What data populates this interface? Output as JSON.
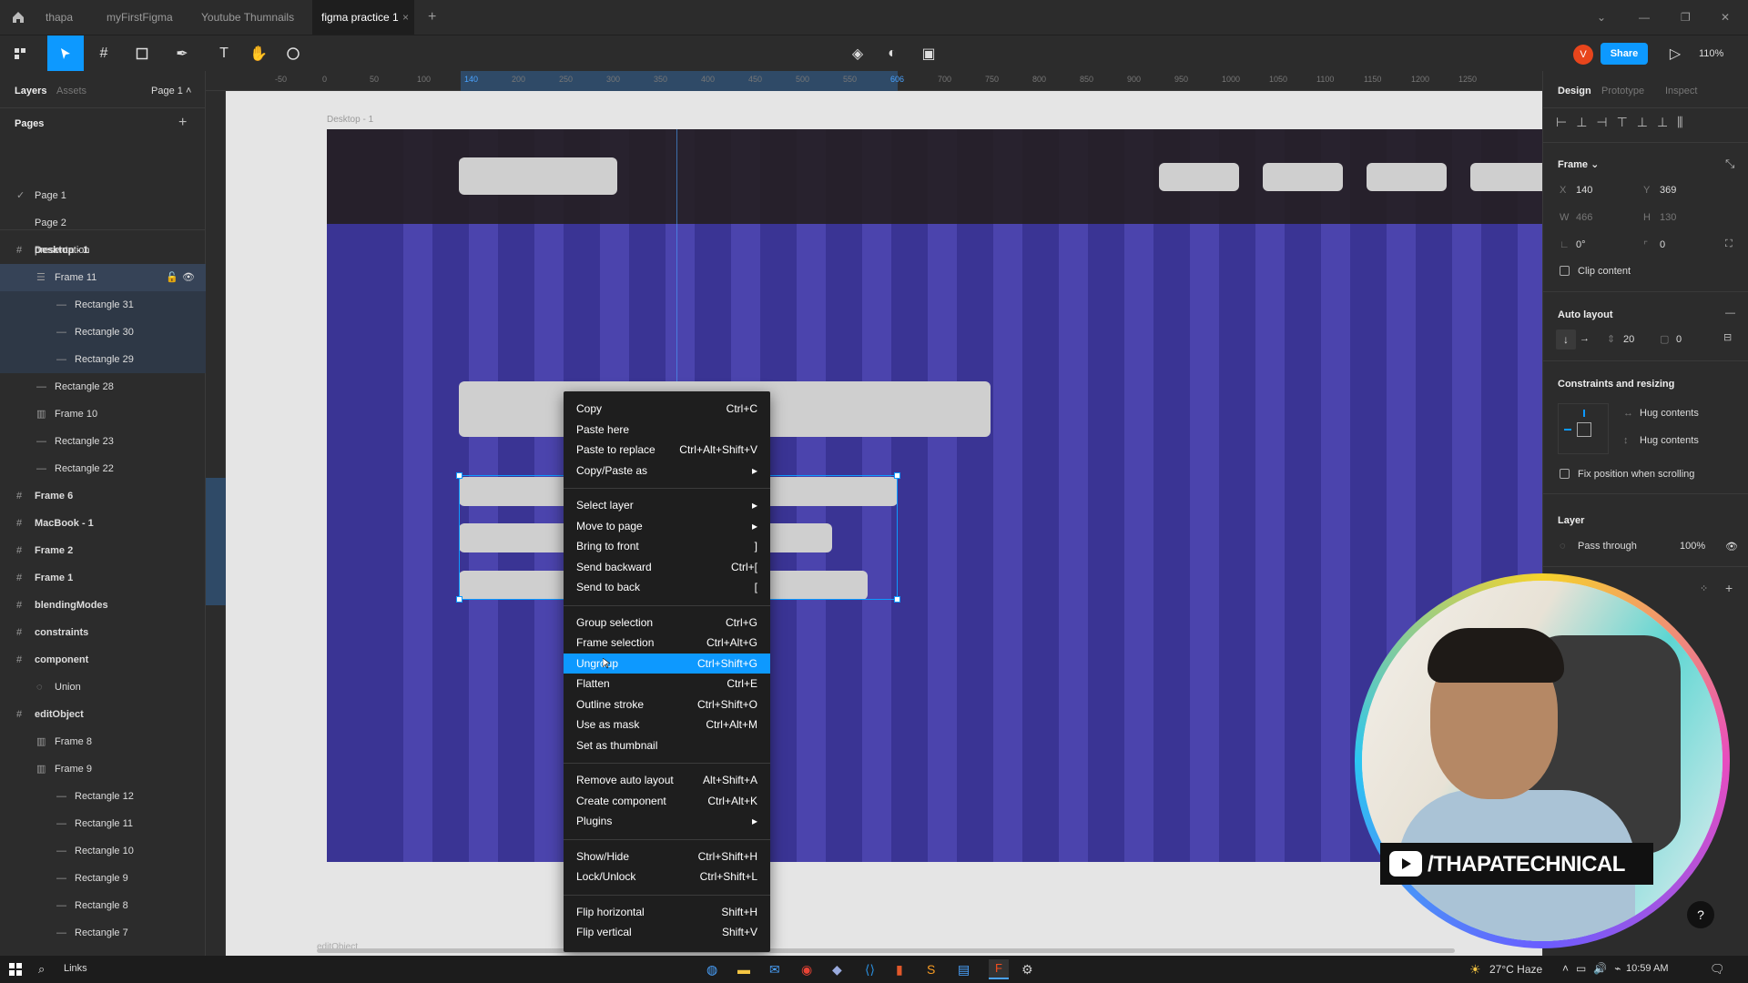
{
  "tabs": [
    {
      "label": "thapa"
    },
    {
      "label": "myFirstFigma"
    },
    {
      "label": "Youtube Thumnails"
    },
    {
      "label": "figma practice 1"
    }
  ],
  "toolbar": {
    "avatar": "V",
    "share": "Share",
    "zoom": "110%"
  },
  "left_panel": {
    "tab_layers": "Layers",
    "tab_assets": "Assets",
    "page_selector": "Page 1",
    "pages_title": "Pages",
    "pages": [
      "Page 1",
      "Page 2",
      "presentation"
    ],
    "layers": [
      {
        "label": "Desktop - 1",
        "icon": "#",
        "indent": 0,
        "bold": true
      },
      {
        "label": "Frame 11",
        "icon": "☰",
        "indent": 1,
        "bold": false,
        "selected": true
      },
      {
        "label": "Rectangle 31",
        "icon": "—",
        "indent": 2,
        "bold": false,
        "child": true
      },
      {
        "label": "Rectangle 30",
        "icon": "—",
        "indent": 2,
        "bold": false,
        "child": true
      },
      {
        "label": "Rectangle 29",
        "icon": "—",
        "indent": 2,
        "bold": false,
        "child": true
      },
      {
        "label": "Rectangle 28",
        "icon": "—",
        "indent": 1,
        "bold": false
      },
      {
        "label": "Frame 10",
        "icon": "▥",
        "indent": 1,
        "bold": false
      },
      {
        "label": "Rectangle 23",
        "icon": "—",
        "indent": 1,
        "bold": false
      },
      {
        "label": "Rectangle 22",
        "icon": "—",
        "indent": 1,
        "bold": false
      },
      {
        "label": "Frame 6",
        "icon": "#",
        "indent": 0,
        "bold": true
      },
      {
        "label": "MacBook - 1",
        "icon": "#",
        "indent": 0,
        "bold": true
      },
      {
        "label": "Frame 2",
        "icon": "#",
        "indent": 0,
        "bold": true
      },
      {
        "label": "Frame 1",
        "icon": "#",
        "indent": 0,
        "bold": true
      },
      {
        "label": "blendingModes",
        "icon": "#",
        "indent": 0,
        "bold": true
      },
      {
        "label": "constraints",
        "icon": "#",
        "indent": 0,
        "bold": true
      },
      {
        "label": "component",
        "icon": "#",
        "indent": 0,
        "bold": true
      },
      {
        "label": "Union",
        "icon": "◌",
        "indent": 1,
        "bold": false
      },
      {
        "label": "editObject",
        "icon": "#",
        "indent": 0,
        "bold": true
      },
      {
        "label": "Frame 8",
        "icon": "▥",
        "indent": 1,
        "bold": false
      },
      {
        "label": "Frame 9",
        "icon": "▥",
        "indent": 1,
        "bold": false
      },
      {
        "label": "Rectangle 12",
        "icon": "—",
        "indent": 2,
        "bold": false
      },
      {
        "label": "Rectangle 11",
        "icon": "—",
        "indent": 2,
        "bold": false
      },
      {
        "label": "Rectangle 10",
        "icon": "—",
        "indent": 2,
        "bold": false
      },
      {
        "label": "Rectangle 9",
        "icon": "—",
        "indent": 2,
        "bold": false
      },
      {
        "label": "Rectangle 8",
        "icon": "—",
        "indent": 2,
        "bold": false
      },
      {
        "label": "Rectangle 7",
        "icon": "—",
        "indent": 2,
        "bold": false
      }
    ]
  },
  "ruler": {
    "top_ticks": [
      "-50",
      "0",
      "50",
      "100",
      "140",
      "200",
      "250",
      "300",
      "350",
      "400",
      "450",
      "500",
      "550",
      "606",
      "700",
      "750",
      "800",
      "850",
      "900",
      "950",
      "1000",
      "1050",
      "1100",
      "1150",
      "1200",
      "1250"
    ],
    "highlight_start": "140",
    "highlight_end": "606"
  },
  "canvas": {
    "frame_label": "Desktop - 1",
    "bottom_label": "editObject"
  },
  "context_menu": {
    "groups": [
      [
        {
          "label": "Copy",
          "shortcut": "Ctrl+C"
        },
        {
          "label": "Paste here",
          "shortcut": ""
        },
        {
          "label": "Paste to replace",
          "shortcut": "Ctrl+Alt+Shift+V"
        },
        {
          "label": "Copy/Paste as",
          "shortcut": "▸"
        }
      ],
      [
        {
          "label": "Select layer",
          "shortcut": "▸"
        },
        {
          "label": "Move to page",
          "shortcut": "▸"
        },
        {
          "label": "Bring to front",
          "shortcut": "]"
        },
        {
          "label": "Send backward",
          "shortcut": "Ctrl+["
        },
        {
          "label": "Send to back",
          "shortcut": "["
        }
      ],
      [
        {
          "label": "Group selection",
          "shortcut": "Ctrl+G"
        },
        {
          "label": "Frame selection",
          "shortcut": "Ctrl+Alt+G"
        },
        {
          "label": "Ungroup",
          "shortcut": "Ctrl+Shift+G",
          "highlighted": true
        },
        {
          "label": "Flatten",
          "shortcut": "Ctrl+E"
        },
        {
          "label": "Outline stroke",
          "shortcut": "Ctrl+Shift+O"
        },
        {
          "label": "Use as mask",
          "shortcut": "Ctrl+Alt+M"
        },
        {
          "label": "Set as thumbnail",
          "shortcut": ""
        }
      ],
      [
        {
          "label": "Remove auto layout",
          "shortcut": "Alt+Shift+A"
        },
        {
          "label": "Create component",
          "shortcut": "Ctrl+Alt+K"
        },
        {
          "label": "Plugins",
          "shortcut": "▸"
        }
      ],
      [
        {
          "label": "Show/Hide",
          "shortcut": "Ctrl+Shift+H"
        },
        {
          "label": "Lock/Unlock",
          "shortcut": "Ctrl+Shift+L"
        }
      ],
      [
        {
          "label": "Flip horizontal",
          "shortcut": "Shift+H"
        },
        {
          "label": "Flip vertical",
          "shortcut": "Shift+V"
        }
      ]
    ]
  },
  "right_panel": {
    "tabs": [
      "Design",
      "Prototype",
      "Inspect"
    ],
    "frame_title": "Frame",
    "x_label": "X",
    "x_value": "140",
    "y_label": "Y",
    "y_value": "369",
    "w_label": "W",
    "w_value": "466",
    "h_label": "H",
    "h_value": "130",
    "rotation": "0°",
    "radius": "0",
    "clip_content": "Clip content",
    "auto_layout_title": "Auto layout",
    "spacing": "20",
    "padding": "0",
    "constraints_title": "Constraints and resizing",
    "hug_h": "Hug contents",
    "hug_v": "Hug contents",
    "fix_position": "Fix position when scrolling",
    "layer_title": "Layer",
    "blend_mode": "Pass through",
    "opacity": "100%"
  },
  "webcam": {
    "channel": "/THAPATECHNICAL"
  },
  "taskbar": {
    "search": "Links",
    "weather": "27°C Haze",
    "time": "10:59 AM"
  },
  "colors": {
    "accent": "#0d99ff",
    "canvas_bg": "#e5e5e5",
    "frame_purple": "#3a3494",
    "header_dark": "#2a2624"
  }
}
